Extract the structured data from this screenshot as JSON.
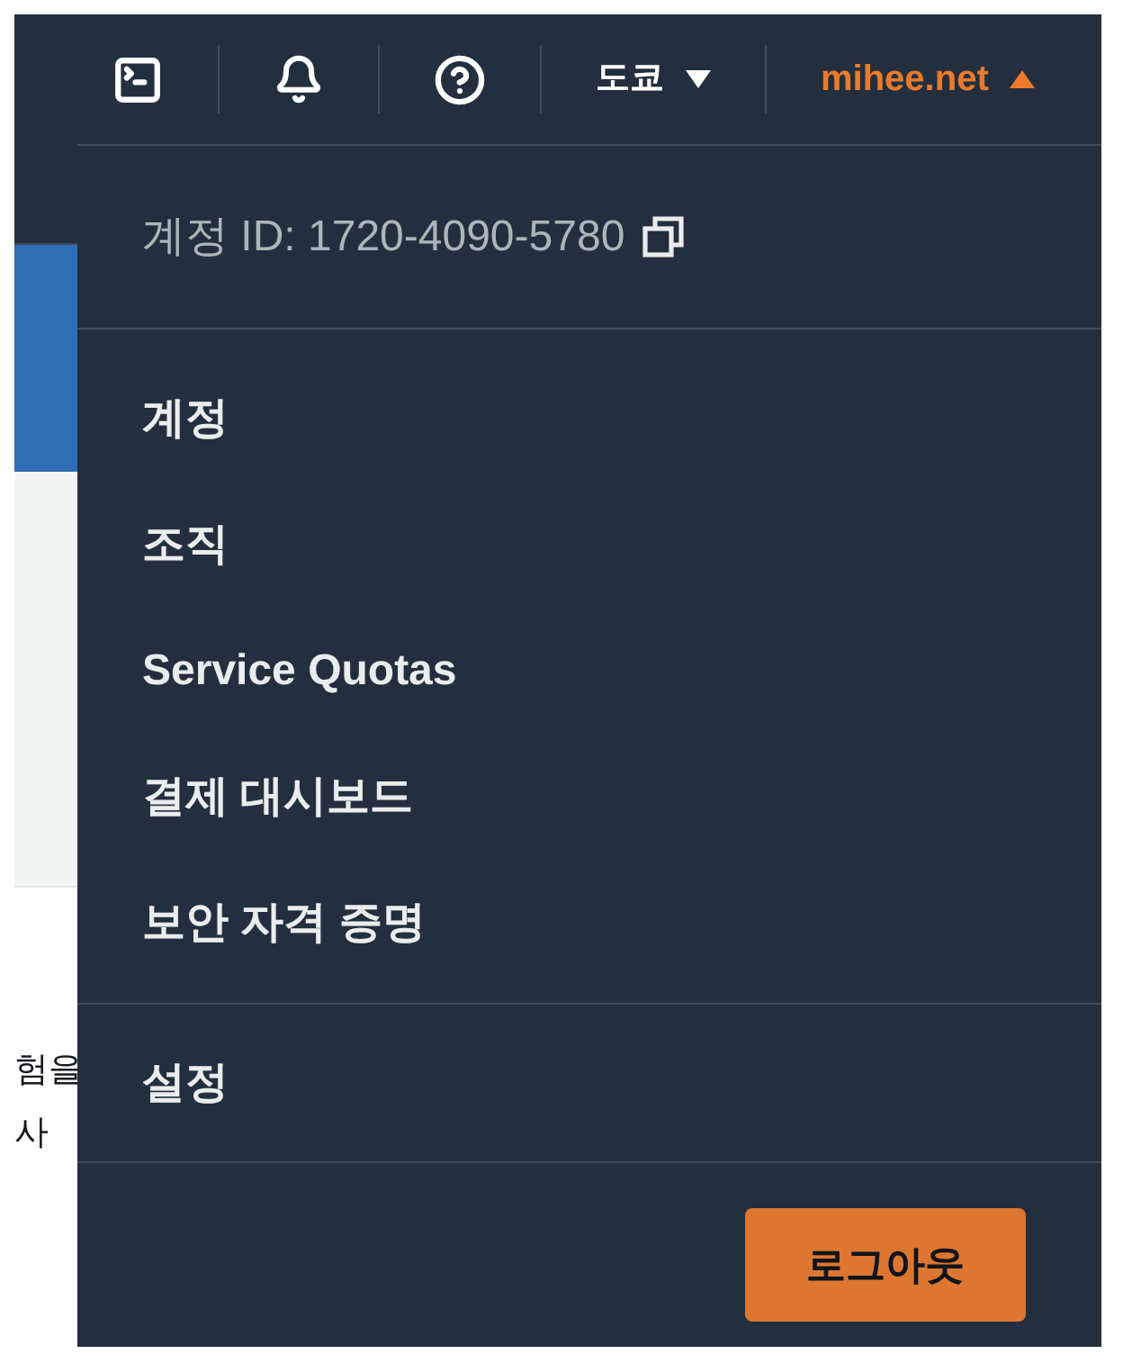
{
  "top_nav": {
    "menus": [
      {
        "label": "도쿄",
        "expanded": false
      },
      {
        "label": "mihee.net",
        "expanded": true
      }
    ]
  },
  "account_menu": {
    "account_id": "계정 ID: 1720-4090-5780",
    "sections": [
      {
        "items": [
          "계정",
          "조직",
          "Service Quotas",
          "결제 대시보드",
          "보안 자격 증명"
        ]
      },
      {
        "items": [
          "설정"
        ]
      }
    ],
    "logout_button": "로그아웃"
  },
  "background_page": {
    "text_lines": [
      "험을",
      "사"
    ]
  }
}
